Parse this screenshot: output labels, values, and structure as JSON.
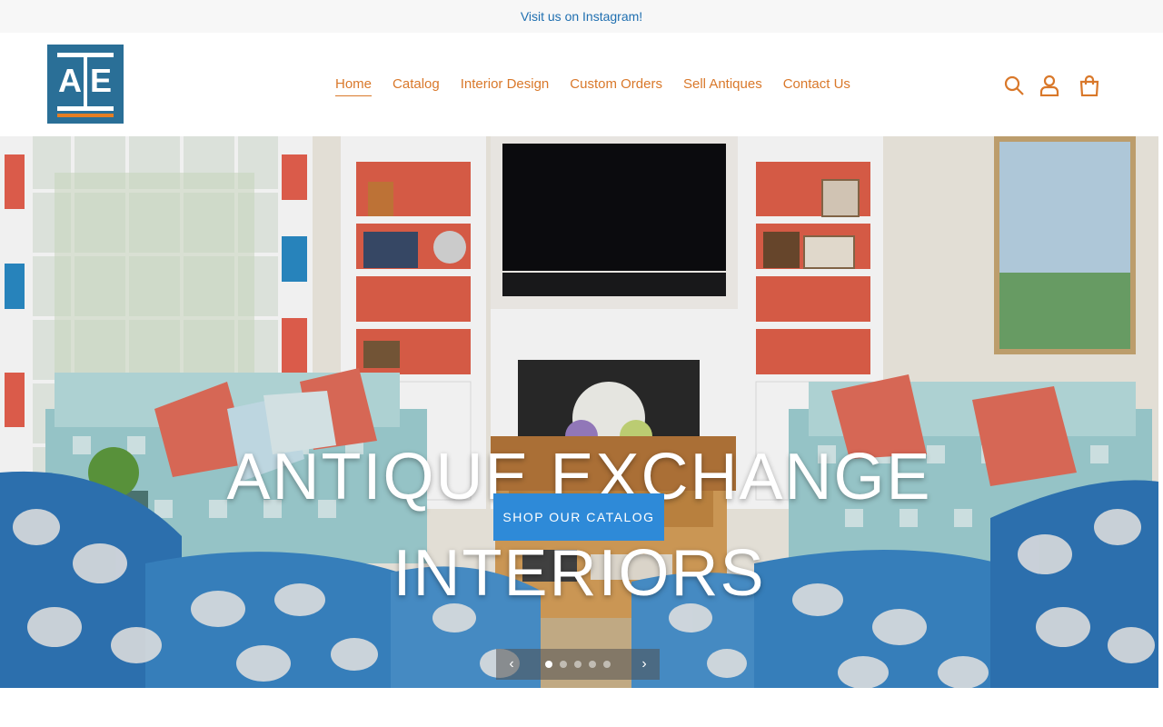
{
  "announcement": {
    "text": "Visit us on Instagram!"
  },
  "logo": {
    "letters": [
      "A",
      "E"
    ],
    "primary_color": "#2a6f97",
    "accent_color": "#e67e22"
  },
  "nav": {
    "items": [
      {
        "label": "Home",
        "active": true
      },
      {
        "label": "Catalog",
        "active": false
      },
      {
        "label": "Interior Design",
        "active": false
      },
      {
        "label": "Custom Orders",
        "active": false
      },
      {
        "label": "Sell Antiques",
        "active": false
      },
      {
        "label": "Contact Us",
        "active": false
      }
    ],
    "color": "#d9782a"
  },
  "header_icons": [
    "search-icon",
    "account-icon",
    "cart-icon"
  ],
  "hero": {
    "title_line1": "ANTIQUE EXCHANGE",
    "title_line2": "INTERIORS",
    "cta_label": "SHOP OUR CATALOG",
    "cta_color": "#2e8ad8",
    "slides_total": 5,
    "active_slide": 1,
    "prev_glyph": "‹",
    "next_glyph": "›"
  }
}
